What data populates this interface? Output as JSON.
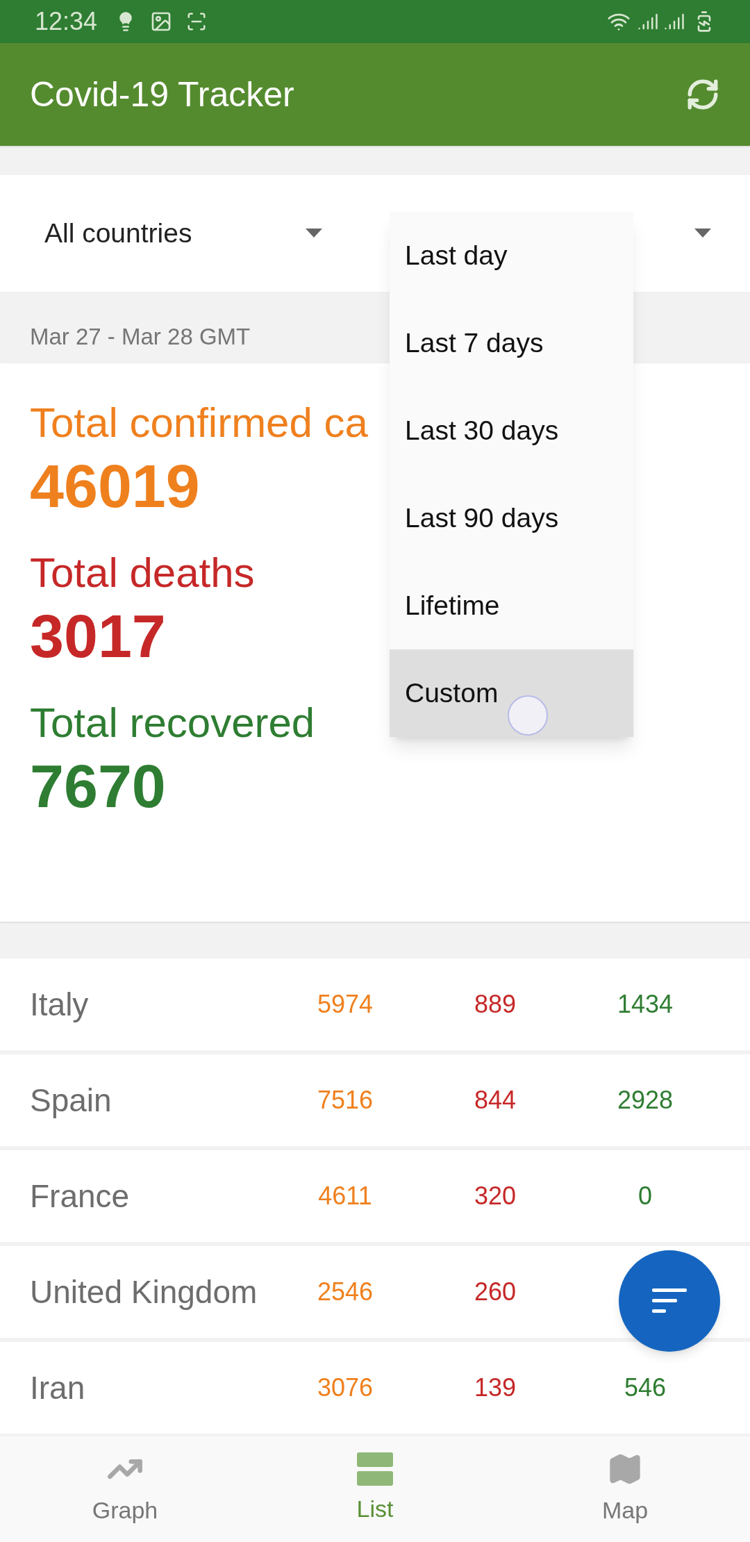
{
  "status_bar": {
    "time": "12:34"
  },
  "app_bar": {
    "title": "Covid-19 Tracker"
  },
  "filters": {
    "country": "All countries"
  },
  "menu": {
    "items": [
      {
        "label": "Last day",
        "selected": false
      },
      {
        "label": "Last 7 days",
        "selected": false
      },
      {
        "label": "Last 30 days",
        "selected": false
      },
      {
        "label": "Last 90 days",
        "selected": false
      },
      {
        "label": "Lifetime",
        "selected": false
      },
      {
        "label": "Custom",
        "selected": true
      }
    ]
  },
  "date_range": "Mar 27 - Mar 28 GMT",
  "totals": [
    {
      "kind": "confirmed",
      "label": "Total confirmed ca",
      "value": "46019"
    },
    {
      "kind": "deaths",
      "label": "Total deaths",
      "value": "3017"
    },
    {
      "kind": "recovered",
      "label": "Total recovered",
      "value": "7670"
    }
  ],
  "rows": [
    {
      "country": "Italy",
      "confirmed": "5974",
      "deaths": "889",
      "recovered": "1434"
    },
    {
      "country": "Spain",
      "confirmed": "7516",
      "deaths": "844",
      "recovered": "2928"
    },
    {
      "country": "France",
      "confirmed": "4611",
      "deaths": "320",
      "recovered": "0"
    },
    {
      "country": "United Kingdom",
      "confirmed": "2546",
      "deaths": "260"
    },
    {
      "country": "Iran",
      "confirmed": "3076",
      "deaths": "139",
      "recovered": "546"
    }
  ],
  "nav": [
    {
      "kind": "graph",
      "label": "Graph",
      "selected": false
    },
    {
      "kind": "list",
      "label": "List",
      "selected": true
    },
    {
      "kind": "map",
      "label": "Map",
      "selected": false
    }
  ]
}
